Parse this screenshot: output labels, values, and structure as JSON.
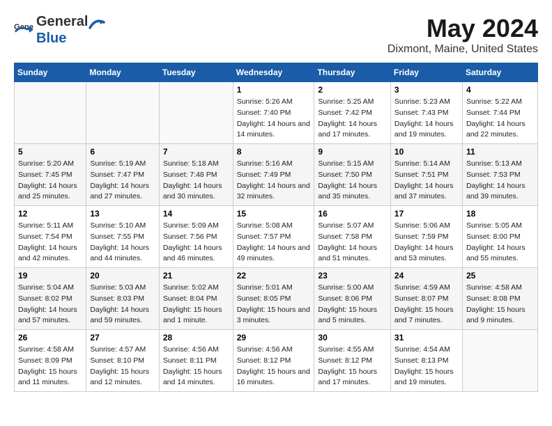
{
  "header": {
    "logo_general": "General",
    "logo_blue": "Blue",
    "title": "May 2024",
    "subtitle": "Dixmont, Maine, United States"
  },
  "weekdays": [
    "Sunday",
    "Monday",
    "Tuesday",
    "Wednesday",
    "Thursday",
    "Friday",
    "Saturday"
  ],
  "weeks": [
    [
      {
        "day": "",
        "sunrise": "",
        "sunset": "",
        "daylight": ""
      },
      {
        "day": "",
        "sunrise": "",
        "sunset": "",
        "daylight": ""
      },
      {
        "day": "",
        "sunrise": "",
        "sunset": "",
        "daylight": ""
      },
      {
        "day": "1",
        "sunrise": "Sunrise: 5:26 AM",
        "sunset": "Sunset: 7:40 PM",
        "daylight": "Daylight: 14 hours and 14 minutes."
      },
      {
        "day": "2",
        "sunrise": "Sunrise: 5:25 AM",
        "sunset": "Sunset: 7:42 PM",
        "daylight": "Daylight: 14 hours and 17 minutes."
      },
      {
        "day": "3",
        "sunrise": "Sunrise: 5:23 AM",
        "sunset": "Sunset: 7:43 PM",
        "daylight": "Daylight: 14 hours and 19 minutes."
      },
      {
        "day": "4",
        "sunrise": "Sunrise: 5:22 AM",
        "sunset": "Sunset: 7:44 PM",
        "daylight": "Daylight: 14 hours and 22 minutes."
      }
    ],
    [
      {
        "day": "5",
        "sunrise": "Sunrise: 5:20 AM",
        "sunset": "Sunset: 7:45 PM",
        "daylight": "Daylight: 14 hours and 25 minutes."
      },
      {
        "day": "6",
        "sunrise": "Sunrise: 5:19 AM",
        "sunset": "Sunset: 7:47 PM",
        "daylight": "Daylight: 14 hours and 27 minutes."
      },
      {
        "day": "7",
        "sunrise": "Sunrise: 5:18 AM",
        "sunset": "Sunset: 7:48 PM",
        "daylight": "Daylight: 14 hours and 30 minutes."
      },
      {
        "day": "8",
        "sunrise": "Sunrise: 5:16 AM",
        "sunset": "Sunset: 7:49 PM",
        "daylight": "Daylight: 14 hours and 32 minutes."
      },
      {
        "day": "9",
        "sunrise": "Sunrise: 5:15 AM",
        "sunset": "Sunset: 7:50 PM",
        "daylight": "Daylight: 14 hours and 35 minutes."
      },
      {
        "day": "10",
        "sunrise": "Sunrise: 5:14 AM",
        "sunset": "Sunset: 7:51 PM",
        "daylight": "Daylight: 14 hours and 37 minutes."
      },
      {
        "day": "11",
        "sunrise": "Sunrise: 5:13 AM",
        "sunset": "Sunset: 7:53 PM",
        "daylight": "Daylight: 14 hours and 39 minutes."
      }
    ],
    [
      {
        "day": "12",
        "sunrise": "Sunrise: 5:11 AM",
        "sunset": "Sunset: 7:54 PM",
        "daylight": "Daylight: 14 hours and 42 minutes."
      },
      {
        "day": "13",
        "sunrise": "Sunrise: 5:10 AM",
        "sunset": "Sunset: 7:55 PM",
        "daylight": "Daylight: 14 hours and 44 minutes."
      },
      {
        "day": "14",
        "sunrise": "Sunrise: 5:09 AM",
        "sunset": "Sunset: 7:56 PM",
        "daylight": "Daylight: 14 hours and 46 minutes."
      },
      {
        "day": "15",
        "sunrise": "Sunrise: 5:08 AM",
        "sunset": "Sunset: 7:57 PM",
        "daylight": "Daylight: 14 hours and 49 minutes."
      },
      {
        "day": "16",
        "sunrise": "Sunrise: 5:07 AM",
        "sunset": "Sunset: 7:58 PM",
        "daylight": "Daylight: 14 hours and 51 minutes."
      },
      {
        "day": "17",
        "sunrise": "Sunrise: 5:06 AM",
        "sunset": "Sunset: 7:59 PM",
        "daylight": "Daylight: 14 hours and 53 minutes."
      },
      {
        "day": "18",
        "sunrise": "Sunrise: 5:05 AM",
        "sunset": "Sunset: 8:00 PM",
        "daylight": "Daylight: 14 hours and 55 minutes."
      }
    ],
    [
      {
        "day": "19",
        "sunrise": "Sunrise: 5:04 AM",
        "sunset": "Sunset: 8:02 PM",
        "daylight": "Daylight: 14 hours and 57 minutes."
      },
      {
        "day": "20",
        "sunrise": "Sunrise: 5:03 AM",
        "sunset": "Sunset: 8:03 PM",
        "daylight": "Daylight: 14 hours and 59 minutes."
      },
      {
        "day": "21",
        "sunrise": "Sunrise: 5:02 AM",
        "sunset": "Sunset: 8:04 PM",
        "daylight": "Daylight: 15 hours and 1 minute."
      },
      {
        "day": "22",
        "sunrise": "Sunrise: 5:01 AM",
        "sunset": "Sunset: 8:05 PM",
        "daylight": "Daylight: 15 hours and 3 minutes."
      },
      {
        "day": "23",
        "sunrise": "Sunrise: 5:00 AM",
        "sunset": "Sunset: 8:06 PM",
        "daylight": "Daylight: 15 hours and 5 minutes."
      },
      {
        "day": "24",
        "sunrise": "Sunrise: 4:59 AM",
        "sunset": "Sunset: 8:07 PM",
        "daylight": "Daylight: 15 hours and 7 minutes."
      },
      {
        "day": "25",
        "sunrise": "Sunrise: 4:58 AM",
        "sunset": "Sunset: 8:08 PM",
        "daylight": "Daylight: 15 hours and 9 minutes."
      }
    ],
    [
      {
        "day": "26",
        "sunrise": "Sunrise: 4:58 AM",
        "sunset": "Sunset: 8:09 PM",
        "daylight": "Daylight: 15 hours and 11 minutes."
      },
      {
        "day": "27",
        "sunrise": "Sunrise: 4:57 AM",
        "sunset": "Sunset: 8:10 PM",
        "daylight": "Daylight: 15 hours and 12 minutes."
      },
      {
        "day": "28",
        "sunrise": "Sunrise: 4:56 AM",
        "sunset": "Sunset: 8:11 PM",
        "daylight": "Daylight: 15 hours and 14 minutes."
      },
      {
        "day": "29",
        "sunrise": "Sunrise: 4:56 AM",
        "sunset": "Sunset: 8:12 PM",
        "daylight": "Daylight: 15 hours and 16 minutes."
      },
      {
        "day": "30",
        "sunrise": "Sunrise: 4:55 AM",
        "sunset": "Sunset: 8:12 PM",
        "daylight": "Daylight: 15 hours and 17 minutes."
      },
      {
        "day": "31",
        "sunrise": "Sunrise: 4:54 AM",
        "sunset": "Sunset: 8:13 PM",
        "daylight": "Daylight: 15 hours and 19 minutes."
      },
      {
        "day": "",
        "sunrise": "",
        "sunset": "",
        "daylight": ""
      }
    ]
  ]
}
